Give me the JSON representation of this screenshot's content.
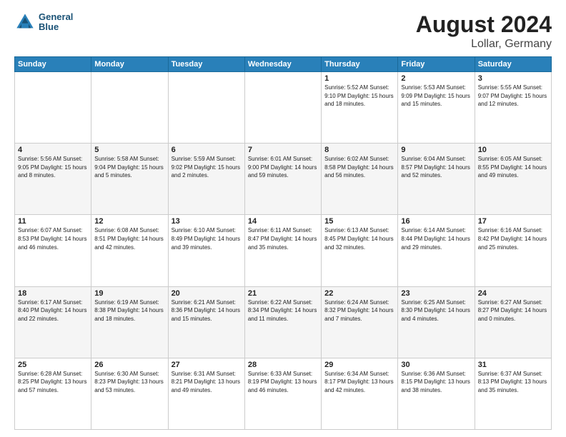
{
  "header": {
    "logo_line1": "General",
    "logo_line2": "Blue",
    "month_title": "August 2024",
    "location": "Lollar, Germany"
  },
  "days_of_week": [
    "Sunday",
    "Monday",
    "Tuesday",
    "Wednesday",
    "Thursday",
    "Friday",
    "Saturday"
  ],
  "weeks": [
    [
      {
        "day": "",
        "info": ""
      },
      {
        "day": "",
        "info": ""
      },
      {
        "day": "",
        "info": ""
      },
      {
        "day": "",
        "info": ""
      },
      {
        "day": "1",
        "info": "Sunrise: 5:52 AM\nSunset: 9:10 PM\nDaylight: 15 hours\nand 18 minutes."
      },
      {
        "day": "2",
        "info": "Sunrise: 5:53 AM\nSunset: 9:09 PM\nDaylight: 15 hours\nand 15 minutes."
      },
      {
        "day": "3",
        "info": "Sunrise: 5:55 AM\nSunset: 9:07 PM\nDaylight: 15 hours\nand 12 minutes."
      }
    ],
    [
      {
        "day": "4",
        "info": "Sunrise: 5:56 AM\nSunset: 9:05 PM\nDaylight: 15 hours\nand 8 minutes."
      },
      {
        "day": "5",
        "info": "Sunrise: 5:58 AM\nSunset: 9:04 PM\nDaylight: 15 hours\nand 5 minutes."
      },
      {
        "day": "6",
        "info": "Sunrise: 5:59 AM\nSunset: 9:02 PM\nDaylight: 15 hours\nand 2 minutes."
      },
      {
        "day": "7",
        "info": "Sunrise: 6:01 AM\nSunset: 9:00 PM\nDaylight: 14 hours\nand 59 minutes."
      },
      {
        "day": "8",
        "info": "Sunrise: 6:02 AM\nSunset: 8:58 PM\nDaylight: 14 hours\nand 56 minutes."
      },
      {
        "day": "9",
        "info": "Sunrise: 6:04 AM\nSunset: 8:57 PM\nDaylight: 14 hours\nand 52 minutes."
      },
      {
        "day": "10",
        "info": "Sunrise: 6:05 AM\nSunset: 8:55 PM\nDaylight: 14 hours\nand 49 minutes."
      }
    ],
    [
      {
        "day": "11",
        "info": "Sunrise: 6:07 AM\nSunset: 8:53 PM\nDaylight: 14 hours\nand 46 minutes."
      },
      {
        "day": "12",
        "info": "Sunrise: 6:08 AM\nSunset: 8:51 PM\nDaylight: 14 hours\nand 42 minutes."
      },
      {
        "day": "13",
        "info": "Sunrise: 6:10 AM\nSunset: 8:49 PM\nDaylight: 14 hours\nand 39 minutes."
      },
      {
        "day": "14",
        "info": "Sunrise: 6:11 AM\nSunset: 8:47 PM\nDaylight: 14 hours\nand 35 minutes."
      },
      {
        "day": "15",
        "info": "Sunrise: 6:13 AM\nSunset: 8:45 PM\nDaylight: 14 hours\nand 32 minutes."
      },
      {
        "day": "16",
        "info": "Sunrise: 6:14 AM\nSunset: 8:44 PM\nDaylight: 14 hours\nand 29 minutes."
      },
      {
        "day": "17",
        "info": "Sunrise: 6:16 AM\nSunset: 8:42 PM\nDaylight: 14 hours\nand 25 minutes."
      }
    ],
    [
      {
        "day": "18",
        "info": "Sunrise: 6:17 AM\nSunset: 8:40 PM\nDaylight: 14 hours\nand 22 minutes."
      },
      {
        "day": "19",
        "info": "Sunrise: 6:19 AM\nSunset: 8:38 PM\nDaylight: 14 hours\nand 18 minutes."
      },
      {
        "day": "20",
        "info": "Sunrise: 6:21 AM\nSunset: 8:36 PM\nDaylight: 14 hours\nand 15 minutes."
      },
      {
        "day": "21",
        "info": "Sunrise: 6:22 AM\nSunset: 8:34 PM\nDaylight: 14 hours\nand 11 minutes."
      },
      {
        "day": "22",
        "info": "Sunrise: 6:24 AM\nSunset: 8:32 PM\nDaylight: 14 hours\nand 7 minutes."
      },
      {
        "day": "23",
        "info": "Sunrise: 6:25 AM\nSunset: 8:30 PM\nDaylight: 14 hours\nand 4 minutes."
      },
      {
        "day": "24",
        "info": "Sunrise: 6:27 AM\nSunset: 8:27 PM\nDaylight: 14 hours\nand 0 minutes."
      }
    ],
    [
      {
        "day": "25",
        "info": "Sunrise: 6:28 AM\nSunset: 8:25 PM\nDaylight: 13 hours\nand 57 minutes."
      },
      {
        "day": "26",
        "info": "Sunrise: 6:30 AM\nSunset: 8:23 PM\nDaylight: 13 hours\nand 53 minutes."
      },
      {
        "day": "27",
        "info": "Sunrise: 6:31 AM\nSunset: 8:21 PM\nDaylight: 13 hours\nand 49 minutes."
      },
      {
        "day": "28",
        "info": "Sunrise: 6:33 AM\nSunset: 8:19 PM\nDaylight: 13 hours\nand 46 minutes."
      },
      {
        "day": "29",
        "info": "Sunrise: 6:34 AM\nSunset: 8:17 PM\nDaylight: 13 hours\nand 42 minutes."
      },
      {
        "day": "30",
        "info": "Sunrise: 6:36 AM\nSunset: 8:15 PM\nDaylight: 13 hours\nand 38 minutes."
      },
      {
        "day": "31",
        "info": "Sunrise: 6:37 AM\nSunset: 8:13 PM\nDaylight: 13 hours\nand 35 minutes."
      }
    ]
  ]
}
